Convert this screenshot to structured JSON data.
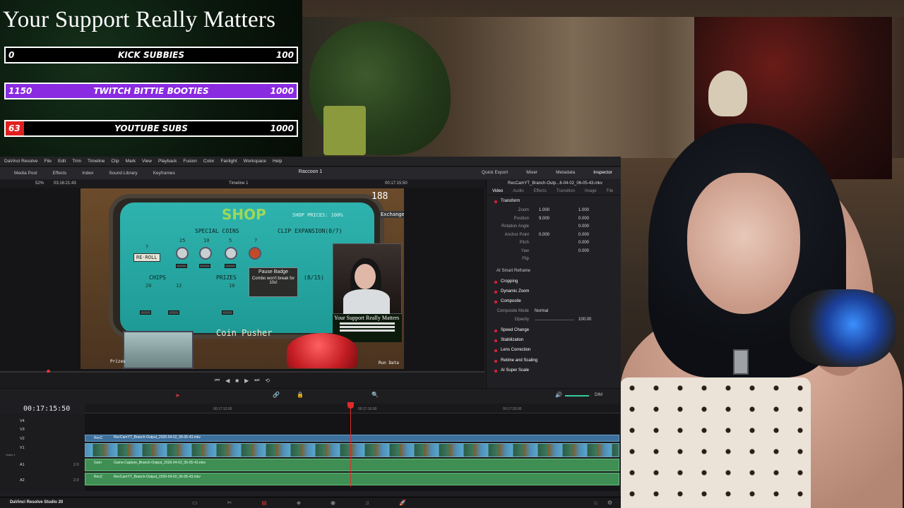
{
  "overlay": {
    "title": "Your Support Really Matters",
    "goals": [
      {
        "current": "0",
        "label": "KICK SUBBIES",
        "goal": "100",
        "progress": 0.0,
        "color": "#1aa34a"
      },
      {
        "current": "1150",
        "label": "TWITCH BITTIE BOOTIES",
        "goal": "1000",
        "progress": 1.0,
        "color": "#8a2be2"
      },
      {
        "current": "63",
        "label": "YOUTUBE SUBS",
        "goal": "1000",
        "progress": 0.063,
        "color": "#e02020"
      }
    ]
  },
  "resolve": {
    "menu": [
      "DaVinci Resolve",
      "File",
      "Edit",
      "Trim",
      "Timeline",
      "Clip",
      "Mark",
      "View",
      "Playback",
      "Fusion",
      "Color",
      "Fairlight",
      "Workspace",
      "Help"
    ],
    "toolbar_left": [
      "Media Pool",
      "Effects",
      "Index",
      "Sound Library",
      "Keyframes"
    ],
    "project_name": "Raccoon 1",
    "toolbar_right": [
      "Quick Export",
      "Mixer",
      "Metadata",
      "Inspector"
    ],
    "viewer": {
      "zoom": "52%",
      "source_timecode": "03:16:21:43",
      "timeline_name": "Timeline 1",
      "record_timecode": "00:17:15:50",
      "clip_name": "RecCamYT_Branch-Outp...6-04-02_06-05-43.mkv"
    },
    "game": {
      "shop_title": "SHOP",
      "shop_prices": "SHOP PRICES: 100%",
      "coins": "188",
      "exchange": "Exchange",
      "special_coins": "SPECIAL COINS",
      "clip_expansion": "CLIP EXPANSION(0/7)",
      "reroll": "RE-ROLL",
      "chips": "CHIPS",
      "prizes": "PRIZES",
      "tooltip_title": "Pause Badge",
      "tooltip_body": "Combo won't break for 10s!",
      "counter": "(8/15)",
      "coin_pusher": "Coin Pusher",
      "prizes_tab": "Prizes",
      "run_data": "Run Data",
      "mini_overlay_title": "Your Support Really Matters",
      "prices": [
        "7",
        "25",
        "10",
        "5",
        "7",
        "20",
        "12",
        "10"
      ],
      "buy": "BUY"
    },
    "inspector": {
      "tabs": [
        "Video",
        "Audio",
        "Effects",
        "Transition",
        "Image",
        "File"
      ],
      "transform": "Transform",
      "rows": [
        {
          "name": "Zoom",
          "x": "1.000",
          "y": "1.000"
        },
        {
          "name": "Position",
          "x": "9.000",
          "y": "0.000"
        },
        {
          "name": "Rotation Angle",
          "x": "",
          "y": "0.000"
        },
        {
          "name": "Anchor Point",
          "x": "0.000",
          "y": "0.000"
        },
        {
          "name": "Pitch",
          "x": "",
          "y": "0.000"
        },
        {
          "name": "Yaw",
          "x": "",
          "y": "0.000"
        },
        {
          "name": "Flip",
          "x": "",
          "y": ""
        }
      ],
      "ai_smart_reframe": "AI Smart Reframe",
      "cropping": "Cropping",
      "dynamic_zoom": "Dynamic Zoom",
      "composite": "Composite",
      "composite_mode_label": "Composite Mode",
      "composite_mode_value": "Normal",
      "opacity_label": "Opacity",
      "opacity_value": "100.00",
      "sections": [
        "Speed Change",
        "Stabilization",
        "Lens Correction",
        "Retime and Scaling",
        "AI Super Scale"
      ]
    },
    "timeline": {
      "timecode": "00:17:15:50",
      "ruler": [
        "00:17:12:00",
        "00:17:16:00",
        "00:17:20:00"
      ],
      "video_tracks": [
        "V4",
        "V3",
        "V2",
        "V1"
      ],
      "audio_tracks": [
        "A1",
        "A2"
      ],
      "video1_label": "Video 1",
      "v2_clip": "RecCamYT_Branch-Output_2026-04-02_06-05-43.mkv",
      "v2_short": "RecC",
      "a1_clip": "Game-Capture_Branch-Output_2026-04-02_06-05-43.mkv",
      "a1_short": "Gam",
      "a2_clip": "RecCamYT_Branch-Output_2026-04-02_06-05-43.mkv",
      "a2_short": "RecC",
      "audio_level": "2.0",
      "dim": "DIM"
    },
    "app_name": "DaVinci Resolve Studio 20"
  }
}
